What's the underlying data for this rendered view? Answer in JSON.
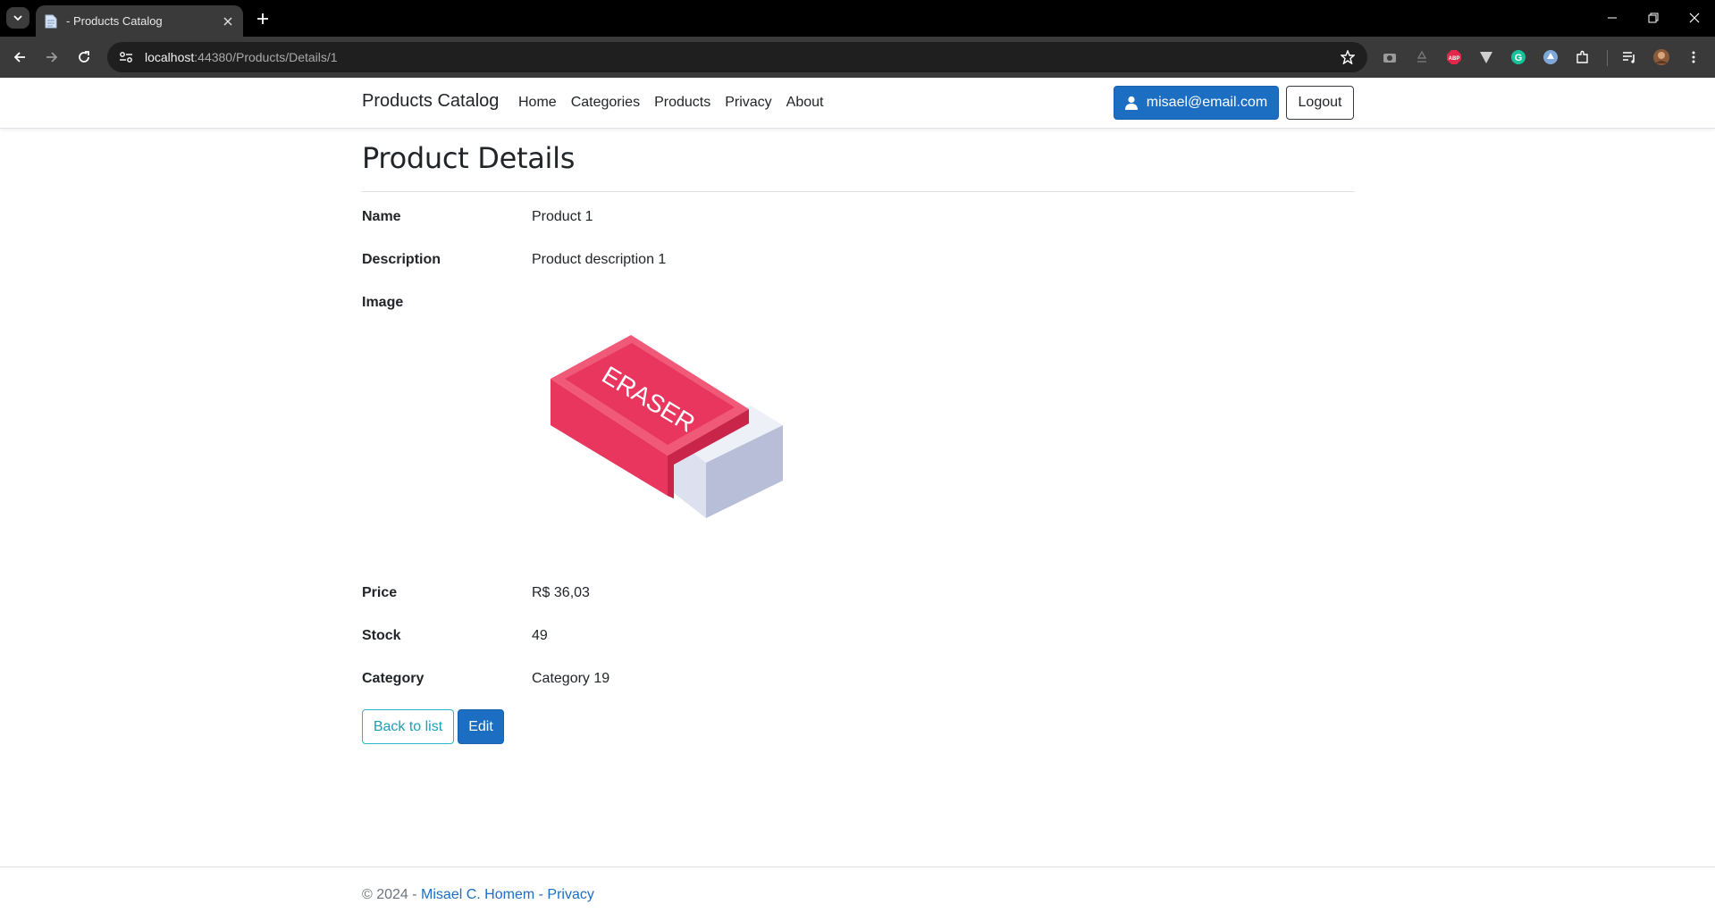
{
  "browser": {
    "tab_title": "- Products Catalog",
    "url_host": "localhost",
    "url_path": ":44380/Products/Details/1"
  },
  "nav": {
    "brand": "Products Catalog",
    "links": [
      "Home",
      "Categories",
      "Products",
      "Privacy",
      "About"
    ],
    "user_email": "misael@email.com",
    "logout": "Logout"
  },
  "page": {
    "title": "Product Details",
    "fields": {
      "name_label": "Name",
      "name_value": "Product 1",
      "description_label": "Description",
      "description_value": "Product description 1",
      "image_label": "Image",
      "image_text": "ERASER",
      "price_label": "Price",
      "price_value": "R$ 36,03",
      "stock_label": "Stock",
      "stock_value": "49",
      "category_label": "Category",
      "category_value": "Category 19"
    },
    "back_button": "Back to list",
    "edit_button": "Edit"
  },
  "footer": {
    "copyright": "© 2024 - ",
    "author": "Misael C. Homem",
    "separator": " - ",
    "privacy": "Privacy"
  },
  "colors": {
    "primary": "#1b6ec2",
    "info": "#1b9fb8",
    "eraser_top": "#f05a78",
    "eraser_side": "#e8365f",
    "eraser_white": "#dde0ee"
  }
}
